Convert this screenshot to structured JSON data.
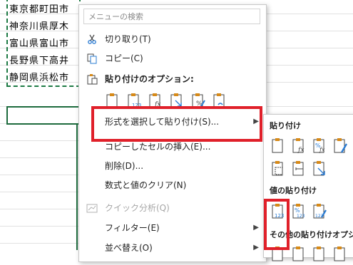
{
  "sheet": {
    "cells": [
      "東京都町田市",
      "神奈川県厚木",
      "富山県富山市",
      "長野県下高井",
      "静岡県浜松市"
    ]
  },
  "menu": {
    "search_placeholder": "メニューの検索",
    "cut": "切り取り(T)",
    "copy": "コピー(C)",
    "paste_options_header": "貼り付けのオプション:",
    "paste_special": "形式を選択して貼り付け(S)...",
    "insert_copied": "コピーしたセルの挿入(E)...",
    "delete": "削除(D)...",
    "clear": "数式と値のクリア(N)",
    "quick_analysis": "クイック分析(Q)",
    "filter": "フィルター(E)",
    "sort": "並べ替え(O)"
  },
  "submenu": {
    "paste_header": "貼り付け",
    "values_header": "値の貼り付け",
    "other_header": "その他の貼り付けオプショ"
  },
  "colors": {
    "highlight": "#e0202a",
    "excel_green": "#1d6b3d",
    "icon_blue": "#2b7cd3",
    "icon_orange": "#d78a18"
  }
}
